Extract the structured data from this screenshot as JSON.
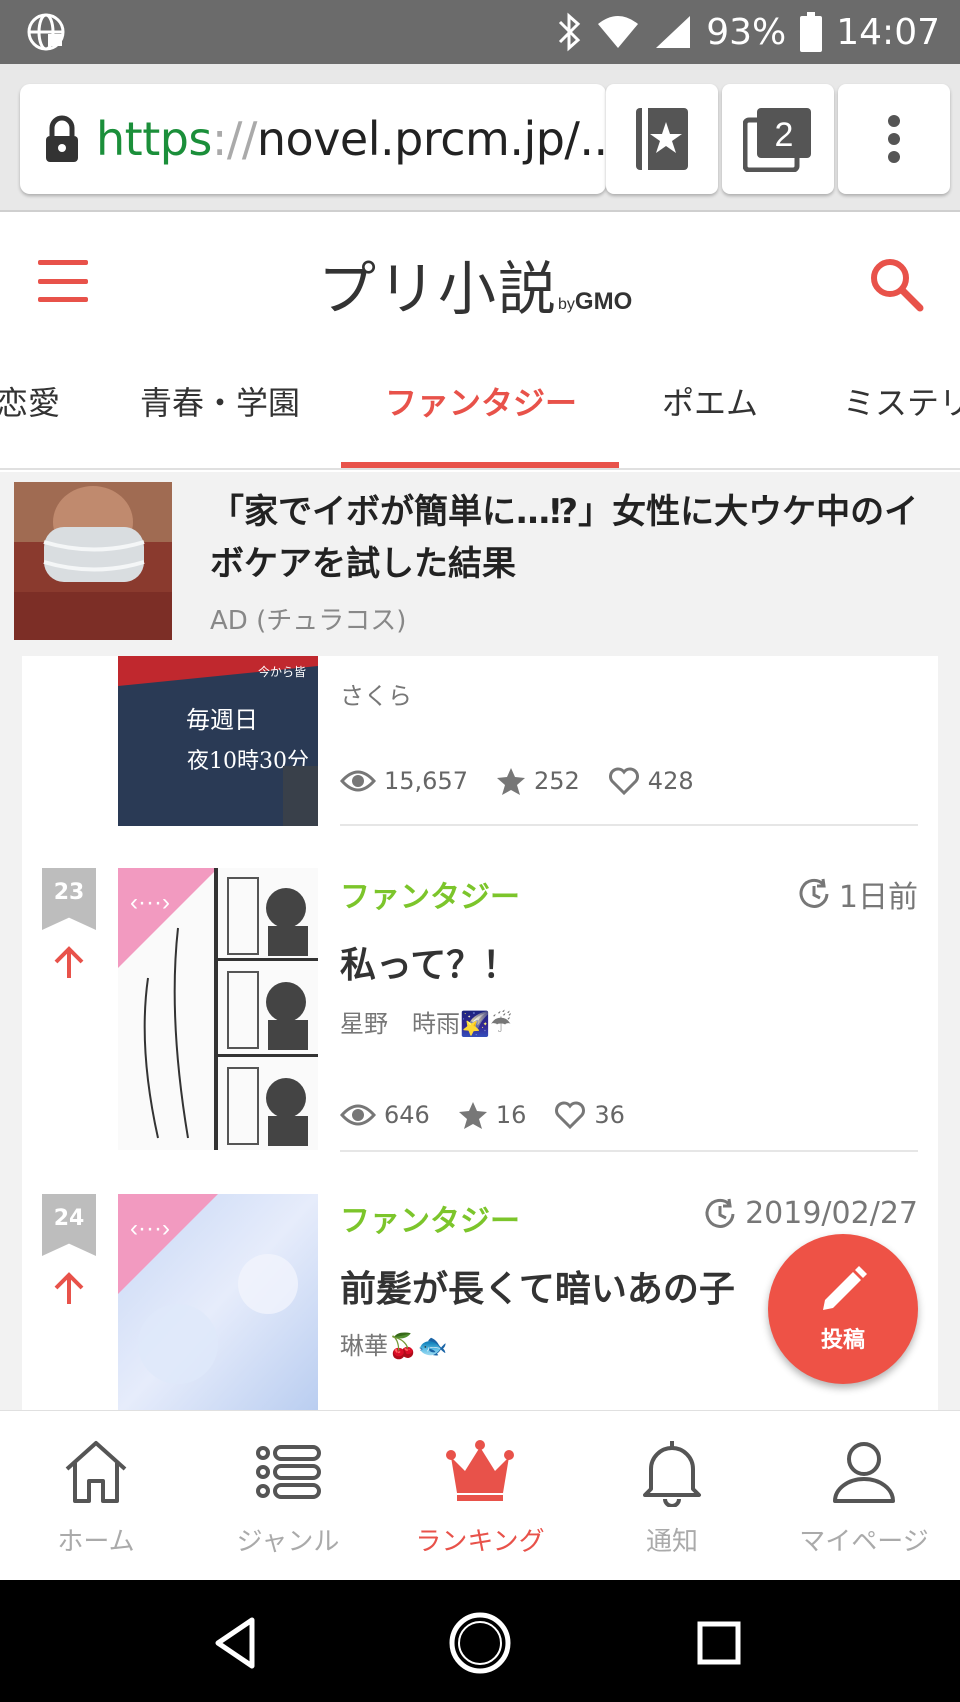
{
  "status_bar": {
    "battery": "93%",
    "time": "14:07"
  },
  "browser": {
    "url_scheme": "https",
    "url_sep": "://",
    "url_host": "novel.prcm.jp/...",
    "tab_count": "2"
  },
  "header": {
    "logo_text": "プリ小説",
    "logo_by": "by",
    "logo_gmo": "GMO"
  },
  "tabs": [
    {
      "label": "恋愛"
    },
    {
      "label": "青春・学園"
    },
    {
      "label": "ファンタジー",
      "active": true
    },
    {
      "label": "ポエム"
    },
    {
      "label": "ミステリ"
    }
  ],
  "ad": {
    "title": "「家でイボが簡単に…⁉」女性に大ウケ中のイボケアを試した結果",
    "source": "AD (チュラコス)"
  },
  "items": [
    {
      "rank": "",
      "thumb_text_1": "毎週日",
      "thumb_text_2": "夜10時30分",
      "thumb_text_top": "今から皆",
      "author": "さくら",
      "views": "15,657",
      "stars": "252",
      "likes": "428"
    },
    {
      "rank": "23",
      "genre": "ファンタジー",
      "time": "1日前",
      "title": "私って？！",
      "author": "星野　時雨",
      "author_emoji": "🌠☔",
      "views": "646",
      "stars": "16",
      "likes": "36"
    },
    {
      "rank": "24",
      "genre": "ファンタジー",
      "time": "2019/02/27",
      "title": "前髪が長くて暗いあの子",
      "author": "琳華",
      "author_emoji": "🍒🐟"
    }
  ],
  "fab": {
    "label": "投稿"
  },
  "bottom_nav": [
    {
      "label": "ホーム",
      "icon": "home-icon"
    },
    {
      "label": "ジャンル",
      "icon": "list-icon"
    },
    {
      "label": "ランキング",
      "icon": "crown-icon",
      "active": true
    },
    {
      "label": "通知",
      "icon": "bell-icon"
    },
    {
      "label": "マイページ",
      "icon": "person-icon"
    }
  ],
  "colors": {
    "accent": "#e8524a",
    "genre": "#7cc52b",
    "status_bar": "#6b6b6b"
  }
}
